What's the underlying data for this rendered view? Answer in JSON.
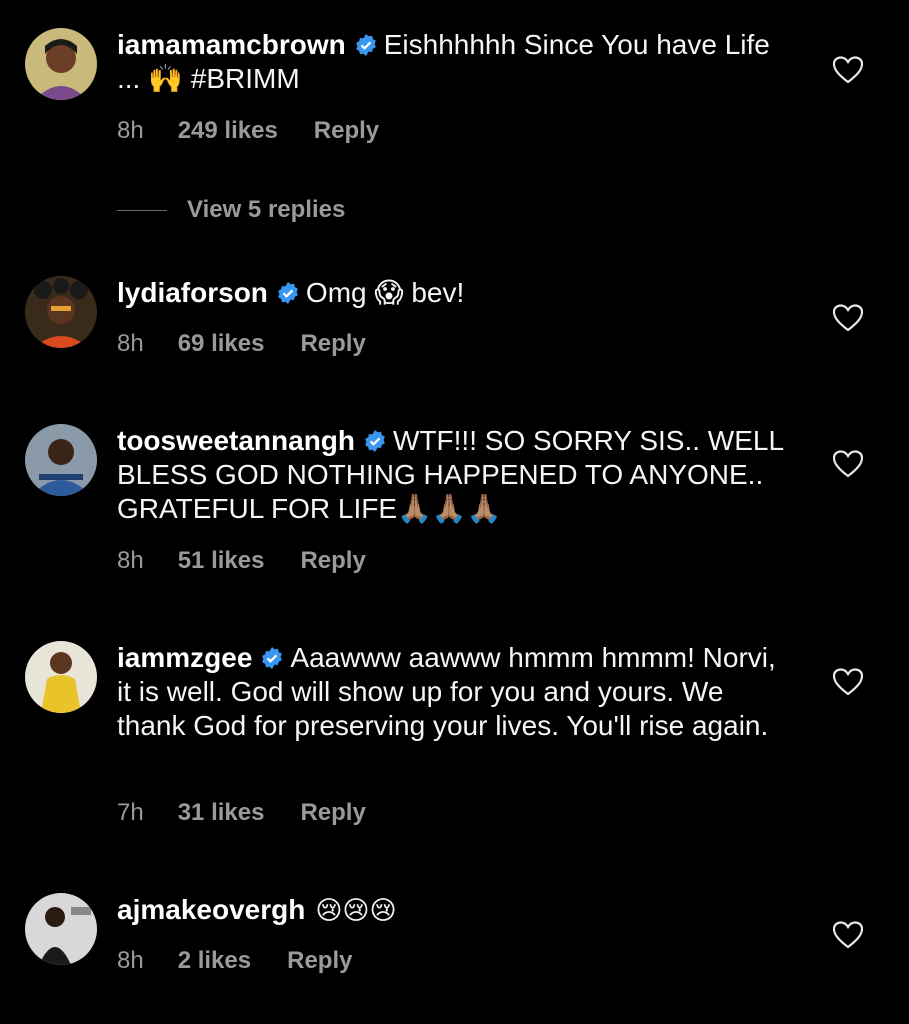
{
  "colors": {
    "background": "#000000",
    "text": "#f5f5f5",
    "muted": "#9a9a9a",
    "verified": "#3897f0"
  },
  "comments": [
    {
      "username": "iamamamcbrown",
      "verified": true,
      "text": "Eishhhhhh  Since You have Life ... 🙌 #BRIMM",
      "time": "8h",
      "likes": "249 likes",
      "reply": "Reply",
      "avatar_icon": "avatar-portrait"
    },
    {
      "username": "lydiaforson",
      "verified": true,
      "text": "Omg 😱 bev!",
      "time": "8h",
      "likes": "69 likes",
      "reply": "Reply",
      "avatar_icon": "avatar-portrait"
    },
    {
      "username": "toosweetannangh",
      "verified": true,
      "text": "WTF!!! SO SORRY SIS.. WELL BLESS GOD NOTHING HAPPENED TO ANYONE.. GRATEFUL FOR LIFE🙏🏽🙏🏽🙏🏽",
      "time": "8h",
      "likes": "51 likes",
      "reply": "Reply",
      "avatar_icon": "avatar-portrait"
    },
    {
      "username": "iammzgee",
      "verified": true,
      "text": "Aaawww aawww hmmm hmmm! Norvi, it is well. God will show up for you and yours. We thank God for preserving your lives. You'll rise again.",
      "time": "7h",
      "likes": "31 likes",
      "reply": "Reply",
      "avatar_icon": "avatar-portrait"
    },
    {
      "username": "ajmakeovergh",
      "verified": false,
      "text": "😢😢😢",
      "time": "8h",
      "likes": "2 likes",
      "reply": "Reply",
      "avatar_icon": "avatar-portrait"
    }
  ],
  "view_replies": "View 5 replies",
  "icons": {
    "like": "heart-outline-icon",
    "verified": "verified-badge-icon"
  }
}
